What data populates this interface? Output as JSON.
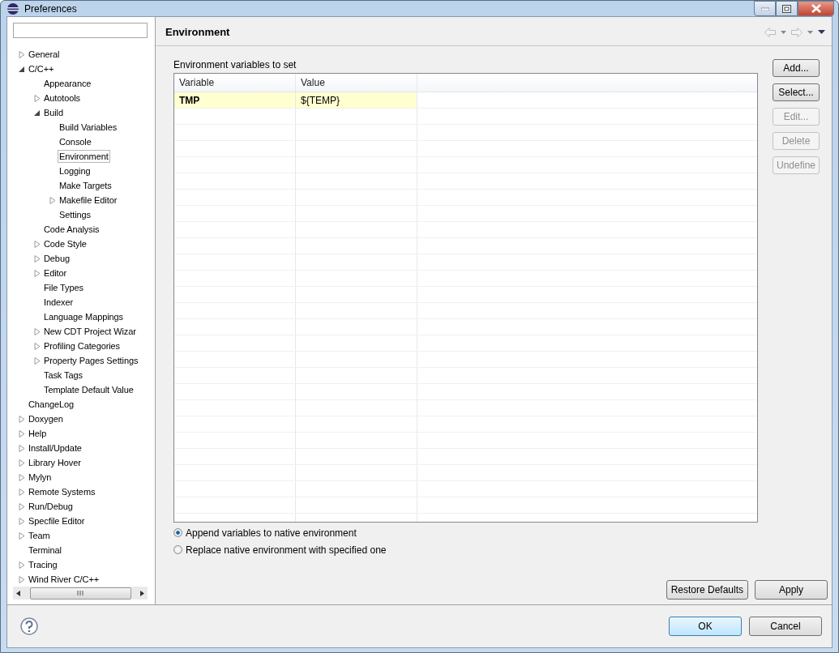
{
  "window": {
    "title": "Preferences"
  },
  "tree": [
    {
      "label": "General",
      "kind": "branch",
      "expanded": false,
      "selected": false
    },
    {
      "label": "C/C++",
      "kind": "branch",
      "expanded": true,
      "selected": false,
      "children": [
        {
          "label": "Appearance",
          "kind": "leaf",
          "selected": false
        },
        {
          "label": "Autotools",
          "kind": "branch",
          "expanded": false,
          "selected": false
        },
        {
          "label": "Build",
          "kind": "branch",
          "expanded": true,
          "selected": false,
          "children": [
            {
              "label": "Build Variables",
              "kind": "leaf",
              "selected": false
            },
            {
              "label": "Console",
              "kind": "leaf",
              "selected": false
            },
            {
              "label": "Environment",
              "kind": "leaf",
              "selected": true
            },
            {
              "label": "Logging",
              "kind": "leaf",
              "selected": false
            },
            {
              "label": "Make Targets",
              "kind": "leaf",
              "selected": false
            },
            {
              "label": "Makefile Editor",
              "kind": "branch",
              "expanded": false,
              "selected": false
            },
            {
              "label": "Settings",
              "kind": "leaf",
              "selected": false
            }
          ]
        },
        {
          "label": "Code Analysis",
          "kind": "leaf",
          "selected": false
        },
        {
          "label": "Code Style",
          "kind": "branch",
          "expanded": false,
          "selected": false
        },
        {
          "label": "Debug",
          "kind": "branch",
          "expanded": false,
          "selected": false
        },
        {
          "label": "Editor",
          "kind": "branch",
          "expanded": false,
          "selected": false
        },
        {
          "label": "File Types",
          "kind": "leaf",
          "selected": false
        },
        {
          "label": "Indexer",
          "kind": "leaf",
          "selected": false
        },
        {
          "label": "Language Mappings",
          "kind": "leaf",
          "selected": false
        },
        {
          "label": "New CDT Project Wizar",
          "kind": "branch",
          "expanded": false,
          "selected": false
        },
        {
          "label": "Profiling Categories",
          "kind": "branch",
          "expanded": false,
          "selected": false
        },
        {
          "label": "Property Pages Settings",
          "kind": "branch",
          "expanded": false,
          "selected": false
        },
        {
          "label": "Task Tags",
          "kind": "leaf",
          "selected": false
        },
        {
          "label": "Template Default Value",
          "kind": "leaf",
          "selected": false
        }
      ]
    },
    {
      "label": "ChangeLog",
      "kind": "leaf",
      "selected": false
    },
    {
      "label": "Doxygen",
      "kind": "branch",
      "expanded": false,
      "selected": false
    },
    {
      "label": "Help",
      "kind": "branch",
      "expanded": false,
      "selected": false
    },
    {
      "label": "Install/Update",
      "kind": "branch",
      "expanded": false,
      "selected": false
    },
    {
      "label": "Library Hover",
      "kind": "branch",
      "expanded": false,
      "selected": false
    },
    {
      "label": "Mylyn",
      "kind": "branch",
      "expanded": false,
      "selected": false
    },
    {
      "label": "Remote Systems",
      "kind": "branch",
      "expanded": false,
      "selected": false
    },
    {
      "label": "Run/Debug",
      "kind": "branch",
      "expanded": false,
      "selected": false
    },
    {
      "label": "Specfile Editor",
      "kind": "branch",
      "expanded": false,
      "selected": false
    },
    {
      "label": "Team",
      "kind": "branch",
      "expanded": false,
      "selected": false
    },
    {
      "label": "Terminal",
      "kind": "leaf",
      "selected": false
    },
    {
      "label": "Tracing",
      "kind": "branch",
      "expanded": false,
      "selected": false
    },
    {
      "label": "Wind River C/C++",
      "kind": "branch",
      "expanded": false,
      "selected": false
    }
  ],
  "page": {
    "title": "Environment",
    "table_label": "Environment variables to set",
    "table": {
      "columns": [
        "Variable",
        "Value"
      ],
      "rows": [
        {
          "variable": "TMP",
          "value": "${TEMP}"
        }
      ]
    },
    "side_buttons": [
      {
        "label": "Add...",
        "disabled": false
      },
      {
        "label": "Select...",
        "disabled": false
      },
      {
        "label": "Edit...",
        "disabled": true
      },
      {
        "label": "Delete",
        "disabled": true
      },
      {
        "label": "Undefine",
        "disabled": true
      }
    ],
    "options": [
      {
        "label": "Append variables to native environment",
        "selected": true
      },
      {
        "label": "Replace native environment with specified one",
        "selected": false
      }
    ],
    "buttons": [
      "Restore Defaults",
      "Apply"
    ]
  },
  "dialog_buttons": [
    {
      "label": "OK",
      "default": true
    },
    {
      "label": "Cancel",
      "default": false
    }
  ]
}
